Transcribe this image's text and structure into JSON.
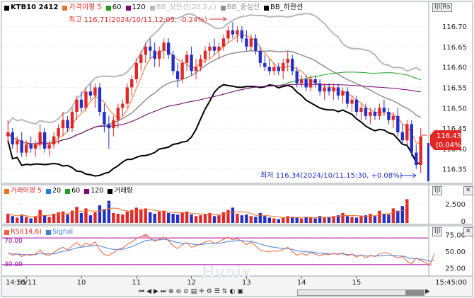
{
  "price_legend": {
    "symbol": "KTB10 2412",
    "ma": "가격이평 5",
    "ma60": "60",
    "ma120": "120",
    "bb_upper": "BB_상한선(20,2,c)",
    "bb_mid": "BB_중심선",
    "bb_lower": "BB_하한선"
  },
  "annotations": {
    "high": "최고 116.71(2024/10/11,12:05, -0.24%)",
    "low": "최저 116.34(2024/10/11,15:30, +0.08%)",
    "last_price": "116.43",
    "last_change": "(0.04%)"
  },
  "volume_legend": {
    "ma": "거래이평 5",
    "ma20": "20",
    "ma60": "60",
    "ma120": "120",
    "volume": "거래량"
  },
  "rsi_legend": {
    "rsi": "RSI(14,6)",
    "signal": "Signal",
    "level70": "70.00",
    "level30": "30.00"
  },
  "price_axis_ticks": [
    "116.70",
    "116.65",
    "116.60",
    "116.55",
    "116.50",
    "116.45",
    "116.40",
    "116.35"
  ],
  "volume_axis_ticks": [
    "2,500",
    "0"
  ],
  "rsi_axis_ticks": [
    "75.00",
    "50.00",
    "25.00"
  ],
  "time_axis": {
    "labels": [
      "14:55",
      "10/11",
      "10",
      "11",
      "12",
      "13",
      "14",
      "15"
    ],
    "right_label": "15:45:00"
  },
  "right_tabs": {
    "price_tab": "I|I|Rs",
    "vol_tab": "I|I",
    "rsi_tab": "I|I"
  },
  "watermark": "Hynix",
  "colors": {
    "up": "#e02828",
    "down": "#2030c8",
    "ma5": "#f07020",
    "ma60": "#20a020",
    "ma120": "#800080",
    "bb_upper": "#b8b8b8",
    "bb_mid": "#909090",
    "bb_lower": "#000000",
    "rsi": "#f06040",
    "signal": "#4080e0",
    "rsi_level": "#a000a0",
    "price_tag": "#e02828"
  },
  "chart_data": {
    "type": "candlestick",
    "interval": "5min",
    "ylim": [
      116.32,
      116.74
    ],
    "last": 116.43,
    "high": 116.71,
    "low": 116.34,
    "candles": [
      [
        116.43,
        116.47,
        116.41,
        116.44
      ],
      [
        116.44,
        116.45,
        116.4,
        116.41
      ],
      [
        116.41,
        116.43,
        116.39,
        116.42
      ],
      [
        116.42,
        116.44,
        116.38,
        116.39
      ],
      [
        116.39,
        116.42,
        116.38,
        116.41
      ],
      [
        116.41,
        116.43,
        116.39,
        116.4
      ],
      [
        116.4,
        116.42,
        116.38,
        116.41
      ],
      [
        116.41,
        116.46,
        116.4,
        116.44
      ],
      [
        116.44,
        116.45,
        116.39,
        116.4
      ],
      [
        116.4,
        116.42,
        116.38,
        116.41
      ],
      [
        116.41,
        116.44,
        116.4,
        116.43
      ],
      [
        116.43,
        116.46,
        116.41,
        116.45
      ],
      [
        116.45,
        116.49,
        116.43,
        116.47
      ],
      [
        116.47,
        116.48,
        116.44,
        116.45
      ],
      [
        116.45,
        116.5,
        116.44,
        116.49
      ],
      [
        116.49,
        116.53,
        116.47,
        116.52
      ],
      [
        116.52,
        116.54,
        116.49,
        116.5
      ],
      [
        116.5,
        116.55,
        116.49,
        116.54
      ],
      [
        116.54,
        116.56,
        116.52,
        116.53
      ],
      [
        116.53,
        116.56,
        116.5,
        116.55
      ],
      [
        116.55,
        116.56,
        116.48,
        116.49
      ],
      [
        116.49,
        116.51,
        116.44,
        116.46
      ],
      [
        116.46,
        116.48,
        116.4,
        116.45
      ],
      [
        116.45,
        116.48,
        116.43,
        116.47
      ],
      [
        116.47,
        116.51,
        116.45,
        116.5
      ],
      [
        116.5,
        116.52,
        116.48,
        116.51
      ],
      [
        116.51,
        116.56,
        116.5,
        116.55
      ],
      [
        116.55,
        116.58,
        116.53,
        116.57
      ],
      [
        116.57,
        116.62,
        116.56,
        116.61
      ],
      [
        116.61,
        116.64,
        116.59,
        116.63
      ],
      [
        116.63,
        116.66,
        116.61,
        116.65
      ],
      [
        116.65,
        116.67,
        116.62,
        116.64
      ],
      [
        116.64,
        116.66,
        116.6,
        116.62
      ],
      [
        116.62,
        116.65,
        116.6,
        116.64
      ],
      [
        116.64,
        116.67,
        116.62,
        116.66
      ],
      [
        116.66,
        116.67,
        116.62,
        116.63
      ],
      [
        116.63,
        116.64,
        116.58,
        116.59
      ],
      [
        116.59,
        116.61,
        116.55,
        116.57
      ],
      [
        116.57,
        116.62,
        116.56,
        116.61
      ],
      [
        116.61,
        116.64,
        116.59,
        116.63
      ],
      [
        116.63,
        116.65,
        116.58,
        116.59
      ],
      [
        116.59,
        116.62,
        116.57,
        116.6
      ],
      [
        116.6,
        116.63,
        116.59,
        116.62
      ],
      [
        116.62,
        116.65,
        116.61,
        116.64
      ],
      [
        116.64,
        116.66,
        116.62,
        116.65
      ],
      [
        116.65,
        116.67,
        116.63,
        116.64
      ],
      [
        116.64,
        116.66,
        116.62,
        116.65
      ],
      [
        116.65,
        116.68,
        116.64,
        116.67
      ],
      [
        116.67,
        116.7,
        116.66,
        116.69
      ],
      [
        116.69,
        116.71,
        116.67,
        116.68
      ],
      [
        116.68,
        116.7,
        116.66,
        116.69
      ],
      [
        116.69,
        116.7,
        116.66,
        116.67
      ],
      [
        116.67,
        116.69,
        116.64,
        116.65
      ],
      [
        116.65,
        116.68,
        116.64,
        116.67
      ],
      [
        116.67,
        116.68,
        116.63,
        116.64
      ],
      [
        116.64,
        116.65,
        116.6,
        116.61
      ],
      [
        116.61,
        116.63,
        116.59,
        116.6
      ],
      [
        116.6,
        116.62,
        116.58,
        116.59
      ],
      [
        116.59,
        116.61,
        116.58,
        116.6
      ],
      [
        116.6,
        116.61,
        116.58,
        116.59
      ],
      [
        116.59,
        116.62,
        116.57,
        116.61
      ],
      [
        116.61,
        116.64,
        116.59,
        116.62
      ],
      [
        116.62,
        116.63,
        116.58,
        116.59
      ],
      [
        116.59,
        116.6,
        116.55,
        116.56
      ],
      [
        116.56,
        116.58,
        116.55,
        116.57
      ],
      [
        116.57,
        116.58,
        116.54,
        116.55
      ],
      [
        116.55,
        116.58,
        116.54,
        116.57
      ],
      [
        116.57,
        116.58,
        116.55,
        116.56
      ],
      [
        116.56,
        116.57,
        116.53,
        116.54
      ],
      [
        116.54,
        116.56,
        116.52,
        116.55
      ],
      [
        116.55,
        116.56,
        116.53,
        116.54
      ],
      [
        116.54,
        116.56,
        116.52,
        116.55
      ],
      [
        116.55,
        116.56,
        116.52,
        116.53
      ],
      [
        116.53,
        116.55,
        116.51,
        116.54
      ],
      [
        116.54,
        116.55,
        116.5,
        116.51
      ],
      [
        116.51,
        116.53,
        116.49,
        116.52
      ],
      [
        116.52,
        116.53,
        116.48,
        116.49
      ],
      [
        116.49,
        116.51,
        116.47,
        116.5
      ],
      [
        116.5,
        116.51,
        116.47,
        116.48
      ],
      [
        116.48,
        116.5,
        116.46,
        116.49
      ],
      [
        116.49,
        116.5,
        116.47,
        116.48
      ],
      [
        116.48,
        116.51,
        116.47,
        116.5
      ],
      [
        116.5,
        116.52,
        116.48,
        116.49
      ],
      [
        116.49,
        116.5,
        116.46,
        116.47
      ],
      [
        116.47,
        116.49,
        116.45,
        116.48
      ],
      [
        116.48,
        116.5,
        116.43,
        116.44
      ],
      [
        116.44,
        116.46,
        116.41,
        116.42
      ],
      [
        116.42,
        116.47,
        116.41,
        116.46
      ],
      [
        116.46,
        116.47,
        116.38,
        116.39
      ],
      [
        116.39,
        116.41,
        116.35,
        116.36
      ],
      [
        116.36,
        116.45,
        116.34,
        116.43
      ]
    ],
    "volume": [
      1200,
      900,
      700,
      1100,
      800,
      600,
      900,
      1700,
      1000,
      800,
      1200,
      1400,
      1500,
      1100,
      1600,
      2100,
      1300,
      1900,
      1000,
      1400,
      2300,
      1800,
      2900,
      1300,
      1200,
      1100,
      1500,
      1700,
      2000,
      1800,
      1900,
      1400,
      1200,
      1500,
      1600,
      1300,
      1200,
      1100,
      1400,
      1500,
      1100,
      900,
      1000,
      1200,
      1300,
      900,
      1000,
      1400,
      1700,
      2000,
      1200,
      1000,
      1100,
      900,
      800,
      1300,
      900,
      700,
      600,
      500,
      700,
      900,
      800,
      700,
      600,
      800,
      700,
      600,
      900,
      700,
      800,
      900,
      1000,
      1300,
      900,
      800,
      700,
      900,
      1000,
      1200,
      900,
      1600,
      1200,
      1100,
      1900,
      1600,
      2200,
      3100
    ],
    "volume_ylim": [
      0,
      3600
    ],
    "rsi_ylim": [
      15,
      85
    ],
    "rsi_levels": [
      70,
      30
    ],
    "rsi": [
      48,
      44,
      46,
      42,
      45,
      44,
      46,
      52,
      45,
      44,
      48,
      53,
      56,
      52,
      58,
      63,
      57,
      62,
      59,
      64,
      52,
      45,
      44,
      48,
      53,
      55,
      60,
      64,
      69,
      72,
      75,
      70,
      65,
      68,
      71,
      66,
      58,
      54,
      60,
      63,
      56,
      58,
      61,
      64,
      66,
      62,
      64,
      68,
      71,
      67,
      69,
      65,
      60,
      64,
      58,
      52,
      50,
      49,
      51,
      50,
      53,
      56,
      50,
      44,
      47,
      44,
      48,
      46,
      43,
      46,
      45,
      47,
      45,
      48,
      43,
      46,
      41,
      45,
      40,
      44,
      42,
      46,
      48,
      47,
      43,
      40,
      42,
      35,
      31,
      40,
      36,
      33,
      29,
      47
    ],
    "signal": [
      47,
      46,
      46,
      45,
      45,
      45,
      45,
      47,
      46,
      46,
      46,
      48,
      50,
      51,
      53,
      55,
      56,
      57,
      58,
      59,
      58,
      56,
      54,
      53,
      53,
      53,
      55,
      57,
      60,
      63,
      66,
      67,
      67,
      67,
      68,
      67,
      65,
      63,
      62,
      62,
      61,
      60,
      60,
      61,
      62,
      62,
      62,
      63,
      65,
      65,
      66,
      66,
      65,
      65,
      63,
      61,
      59,
      57,
      56,
      55,
      54,
      54,
      53,
      51,
      50,
      49,
      49,
      48,
      47,
      47,
      46,
      46,
      46,
      46,
      45,
      45,
      44,
      44,
      43,
      43,
      43,
      43,
      44,
      44,
      44,
      43,
      43,
      41,
      39,
      39,
      38,
      37,
      35,
      37
    ]
  }
}
